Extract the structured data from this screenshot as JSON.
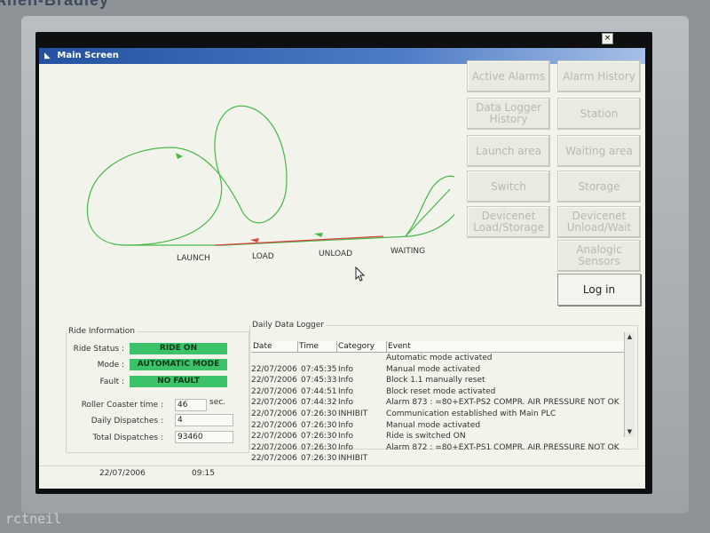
{
  "brand": "Allen-Bradley",
  "window": {
    "title": "Main Screen",
    "close": "×"
  },
  "track": {
    "labels": {
      "launch": "LAUNCH",
      "load": "LOAD",
      "unload": "UNLOAD",
      "waiting": "WAITING"
    },
    "colors": {
      "track": "#47b84a",
      "red": "#d94040"
    }
  },
  "nav": {
    "active_alarms": "Active Alarms",
    "alarm_history": "Alarm History",
    "data_logger_history": "Data Logger History",
    "station": "Station",
    "launch_area": "Launch area",
    "waiting_area": "Waiting area",
    "switch": "Switch",
    "storage": "Storage",
    "devicenet_load_storage": "Devicenet Load/Storage",
    "devicenet_unload_wait": "Devicenet Unload/Wait",
    "analogic_sensors": "Analogic Sensors",
    "log_in": "Log in"
  },
  "ride_info": {
    "title": "Ride Information",
    "status_label": "Ride Status :",
    "status_value": "RIDE ON",
    "mode_label": "Mode :",
    "mode_value": "AUTOMATIC MODE",
    "fault_label": "Fault :",
    "fault_value": "NO FAULT",
    "coaster_time_label": "Roller Coaster time :",
    "coaster_time_value": "46",
    "coaster_time_unit": "sec.",
    "daily_dispatches_label": "Daily Dispatches :",
    "daily_dispatches_value": "4",
    "total_dispatches_label": "Total Dispatches :",
    "total_dispatches_value": "93460",
    "badge_color": "#3cc36a"
  },
  "logger": {
    "title": "Daily Data Logger",
    "columns": {
      "date": "Date",
      "time": "Time",
      "category": "Category",
      "event": "Event"
    },
    "rows": [
      {
        "date": "",
        "time": "",
        "category": "",
        "event": "Automatic mode activated"
      },
      {
        "date": "22/07/2006",
        "time": "07:45:35",
        "category": "Info",
        "event": "Manual mode activated"
      },
      {
        "date": "22/07/2006",
        "time": "07:45:33",
        "category": "Info",
        "event": "Block 1.1 manually reset"
      },
      {
        "date": "22/07/2006",
        "time": "07:44:51",
        "category": "Info",
        "event": "Block reset mode activated"
      },
      {
        "date": "22/07/2006",
        "time": "07:44:32",
        "category": "Info",
        "event": "Alarm 873 :   =80+EXT-PS2    COMPR. AIR PRESSURE NOT OK"
      },
      {
        "date": "22/07/2006",
        "time": "07:26:30",
        "category": "INHIBIT",
        "event": "Communication established with Main PLC"
      },
      {
        "date": "22/07/2006",
        "time": "07:26:30",
        "category": "Info",
        "event": "Manual mode activated"
      },
      {
        "date": "22/07/2006",
        "time": "07:26:30",
        "category": "Info",
        "event": "Ride is switched ON"
      },
      {
        "date": "22/07/2006",
        "time": "07:26:30",
        "category": "Info",
        "event": "Alarm 872 :   =80+EXT-PS1    COMPR. AIR PRESSURE NOT OK"
      },
      {
        "date": "22/07/2006",
        "time": "07:26:30",
        "category": "INHIBIT",
        "event": ""
      }
    ]
  },
  "status_bar": {
    "date": "22/07/2006",
    "time": "09:15"
  },
  "watermark": "rctneil"
}
